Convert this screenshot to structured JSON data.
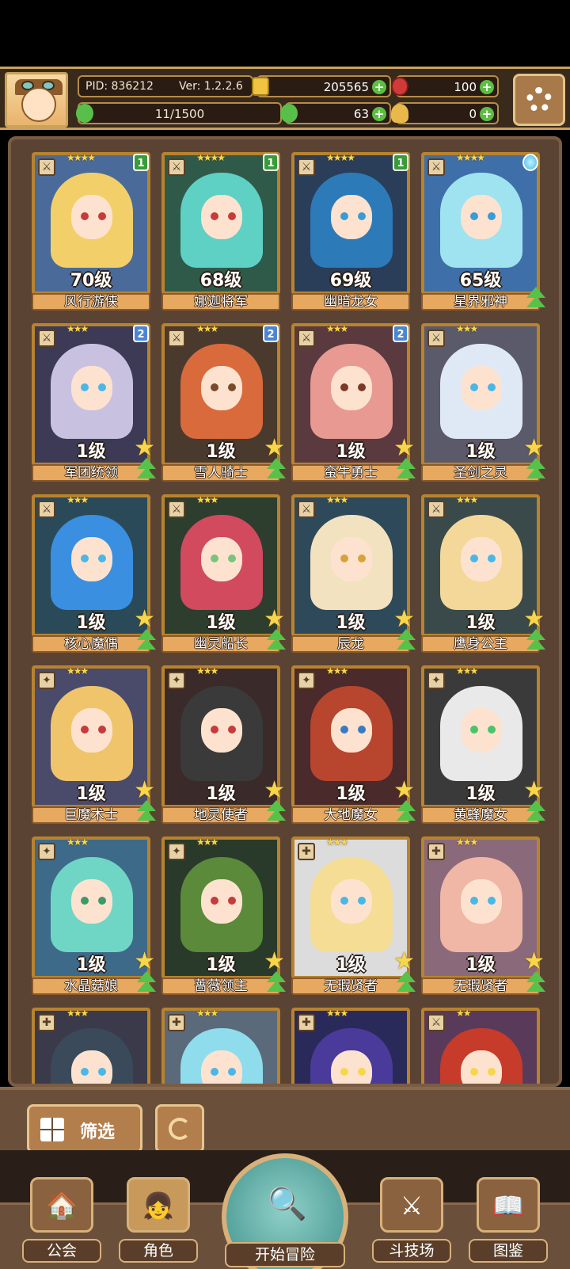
{
  "player": {
    "pid_label": "PID: 836212",
    "version_label": "Ver: 1.2.2.6",
    "gold": "205565",
    "gems": "100",
    "xp": "11/1500",
    "clover": "63",
    "potion": "0"
  },
  "colors": {
    "panel_bg": "#5a4333",
    "frame_gold": "#b8832f",
    "plus_green": "#5cbf43"
  },
  "heroes": [
    {
      "name": "风行游侠",
      "level": "70级",
      "badge": "1",
      "badge_type": "green",
      "stars": "★★★★",
      "hair": "#f3cf6a",
      "eye": "#c63b3b",
      "bg": "#4a6b99",
      "role": "⚔"
    },
    {
      "name": "娜迦将军",
      "level": "68级",
      "badge": "1",
      "badge_type": "green",
      "stars": "★★★★",
      "hair": "#5fd0c4",
      "eye": "#c63b3b",
      "bg": "#2f5a4a",
      "role": "⚔"
    },
    {
      "name": "幽暗龙女",
      "level": "69级",
      "badge": "1",
      "badge_type": "green",
      "stars": "★★★★",
      "hair": "#2d7ab8",
      "eye": "#3a9bd6",
      "bg": "#2a3e5a",
      "role": "⚔"
    },
    {
      "name": "星界邪神",
      "level": "65级",
      "badge": "",
      "badge_type": "orb",
      "stars": "★★★★",
      "hair": "#9fe3f0",
      "eye": "#3a9bd6",
      "bg": "#3e6fa8",
      "role": "⚔"
    },
    {
      "name": "军团统领",
      "level": "1级",
      "badge": "2",
      "badge_type": "blue",
      "stars": "★★★",
      "hair": "#c8c2e0",
      "eye": "#4ab7e6",
      "bg": "#3c3a55",
      "role": "⚔"
    },
    {
      "name": "雪人骑士",
      "level": "1级",
      "badge": "2",
      "badge_type": "blue",
      "stars": "★★★",
      "hair": "#d96a3c",
      "eye": "#7a4a2a",
      "bg": "#4a3a2e",
      "role": "⚔"
    },
    {
      "name": "蛮牛勇士",
      "level": "1级",
      "badge": "2",
      "badge_type": "blue",
      "stars": "★★★",
      "hair": "#e89a92",
      "eye": "#7a3a2a",
      "bg": "#5a3a3e",
      "role": "⚔"
    },
    {
      "name": "圣剑之灵",
      "level": "1级",
      "badge": "",
      "badge_type": "",
      "stars": "★★★",
      "hair": "#dfe9f5",
      "eye": "#4ab7e6",
      "bg": "#5a5a6a",
      "role": "⚔"
    },
    {
      "name": "核心魔偶",
      "level": "1级",
      "badge": "",
      "badge_type": "",
      "stars": "★★★",
      "hair": "#3a8fe0",
      "eye": "#4ab7e6",
      "bg": "#2a4a5a",
      "role": "⚔"
    },
    {
      "name": "幽灵船长",
      "level": "1级",
      "badge": "",
      "badge_type": "",
      "stars": "★★★",
      "hair": "#d14a5e",
      "eye": "#7ac47a",
      "bg": "#2e3e2e",
      "role": "⚔"
    },
    {
      "name": "辰龙",
      "level": "1级",
      "badge": "",
      "badge_type": "",
      "stars": "★★★",
      "hair": "#f3e2c0",
      "eye": "#d6a33a",
      "bg": "#2e4a5a",
      "role": "⚔"
    },
    {
      "name": "鹰身公主",
      "level": "1级",
      "badge": "",
      "badge_type": "",
      "stars": "★★★",
      "hair": "#f3d89a",
      "eye": "#4ab7e6",
      "bg": "#3a4a4a",
      "role": "⚔"
    },
    {
      "name": "巨魔术士",
      "level": "1级",
      "badge": "",
      "badge_type": "",
      "stars": "★★★",
      "hair": "#f0c46a",
      "eye": "#c63b3b",
      "bg": "#4a4a6a",
      "role": "✦"
    },
    {
      "name": "地灵使者",
      "level": "1级",
      "badge": "",
      "badge_type": "",
      "stars": "★★★",
      "hair": "#3a3a3a",
      "eye": "#c63b3b",
      "bg": "#3a2a2a",
      "role": "✦"
    },
    {
      "name": "大地魔女",
      "level": "1级",
      "badge": "",
      "badge_type": "",
      "stars": "★★★",
      "hair": "#b8452e",
      "eye": "#3a7ac4",
      "bg": "#4a2a2a",
      "role": "✦"
    },
    {
      "name": "黄蜂魔女",
      "level": "1级",
      "badge": "",
      "badge_type": "",
      "stars": "★★★",
      "hair": "#e9e9e9",
      "eye": "#4ac46a",
      "bg": "#3a3a3a",
      "role": "✦"
    },
    {
      "name": "水晶菇娘",
      "level": "1级",
      "badge": "",
      "badge_type": "",
      "stars": "★★★",
      "hair": "#6fd6c6",
      "eye": "#3a9b6a",
      "bg": "#3e6a8a",
      "role": "✦"
    },
    {
      "name": "蔷薇领主",
      "level": "1级",
      "badge": "",
      "badge_type": "",
      "stars": "★★★",
      "hair": "#5a8a3a",
      "eye": "#c63b3b",
      "bg": "#2a3a2a",
      "role": "✦"
    },
    {
      "name": "无瑕贤者",
      "level": "1级",
      "badge": "",
      "badge_type": "",
      "stars": "★★★",
      "hair": "#f6dd96",
      "eye": "#4ab7e6",
      "bg": "#dcdcdc",
      "role": "✚"
    },
    {
      "name": "无瑕贤者",
      "level": "1级",
      "badge": "",
      "badge_type": "",
      "stars": "★★★",
      "hair": "#f0b6a6",
      "eye": "#4ab7e6",
      "bg": "#8a6a7a",
      "role": "✚"
    },
    {
      "name": "",
      "level": "",
      "badge": "",
      "badge_type": "",
      "stars": "★★★",
      "hair": "#3a4a5a",
      "eye": "#4ab7e6",
      "bg": "#3a3a4a",
      "role": "✚"
    },
    {
      "name": "",
      "level": "",
      "badge": "",
      "badge_type": "",
      "stars": "★★★",
      "hair": "#8fdcec",
      "eye": "#4ab7e6",
      "bg": "#5a6a7a",
      "role": "✚"
    },
    {
      "name": "",
      "level": "",
      "badge": "",
      "badge_type": "",
      "stars": "★★★",
      "hair": "#4a3a9a",
      "eye": "#f7d64a",
      "bg": "#2a2a5a",
      "role": "✚"
    },
    {
      "name": "",
      "level": "",
      "badge": "",
      "badge_type": "",
      "stars": "★★",
      "hair": "#c63b2a",
      "eye": "#f7d64a",
      "bg": "#5a3a5a",
      "role": "⚔"
    }
  ],
  "filter": {
    "label": "筛选"
  },
  "nav": {
    "guild": "公会",
    "character": "角色",
    "start": "开始冒险",
    "arena": "斗技场",
    "codex": "图鉴"
  }
}
